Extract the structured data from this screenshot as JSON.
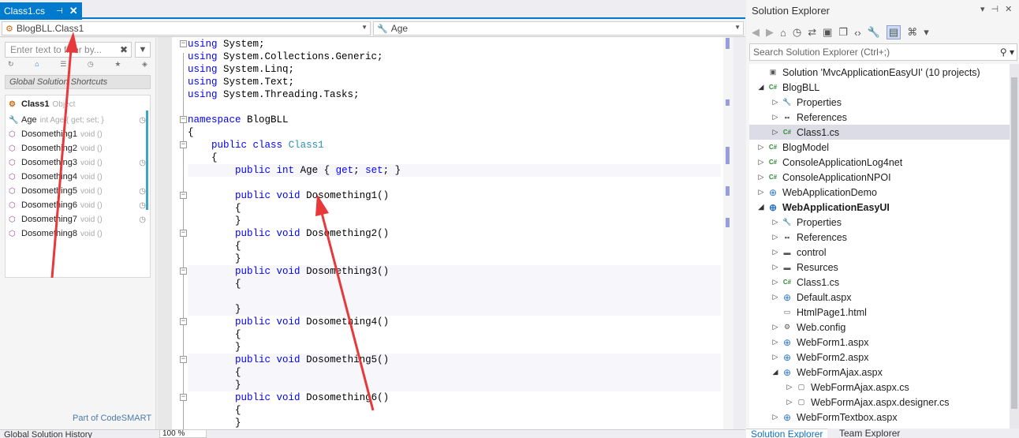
{
  "doc_tab": {
    "title": "Class1.cs",
    "pin_glyph": "⊣",
    "close_glyph": "✕"
  },
  "navbar": {
    "left_value": "BlogBLL.Class1",
    "right_value": "Age"
  },
  "codesmart": {
    "filter_placeholder": "Enter text to filter by...",
    "shortcuts_label": "Global Solution Shortcuts",
    "class_name": "Class1",
    "class_kind": "Object",
    "members": [
      {
        "name": "Age",
        "type": "int Age { get; set; }",
        "icon": "wrench-icon",
        "clock": true
      },
      {
        "name": "Dosomething1",
        "type": "void ()",
        "icon": "method-icon",
        "clock": false
      },
      {
        "name": "Dosomething2",
        "type": "void ()",
        "icon": "method-icon",
        "clock": false
      },
      {
        "name": "Dosomething3",
        "type": "void ()",
        "icon": "method-icon",
        "clock": true
      },
      {
        "name": "Dosomething4",
        "type": "void ()",
        "icon": "method-icon",
        "clock": false
      },
      {
        "name": "Dosomething5",
        "type": "void ()",
        "icon": "method-icon",
        "clock": true
      },
      {
        "name": "Dosomething6",
        "type": "void ()",
        "icon": "method-icon",
        "clock": true
      },
      {
        "name": "Dosomething7",
        "type": "void ()",
        "icon": "method-icon",
        "clock": true
      },
      {
        "name": "Dosomething8",
        "type": "void ()",
        "icon": "method-icon",
        "clock": false
      }
    ],
    "footer_link": "Part of CodeSMART"
  },
  "bottom": {
    "history_label": "Global Solution History",
    "zoom": "100 %"
  },
  "code_lines": [
    "using System;",
    "using System.Collections.Generic;",
    "using System.Linq;",
    "using System.Text;",
    "using System.Threading.Tasks;",
    "",
    "namespace BlogBLL",
    "{",
    "    public class Class1",
    "    {",
    "        public int Age { get; set; }",
    "",
    "        public void Dosomething1()",
    "        {",
    "        }",
    "        public void Dosomething2()",
    "        {",
    "        }",
    "        public void Dosomething3()",
    "        {",
    "",
    "        }",
    "        public void Dosomething4()",
    "        {",
    "        }",
    "        public void Dosomething5()",
    "        {",
    "        }",
    "        public void Dosomething6()",
    "        {",
    "        }"
  ],
  "solution_explorer": {
    "title": "Solution Explorer",
    "search_placeholder": "Search Solution Explorer (Ctrl+;)",
    "tabs": [
      "Solution Explorer",
      "Team Explorer"
    ],
    "tree": [
      {
        "label": "Solution 'MvcApplicationEasyUI' (10 projects)",
        "level": 0,
        "arrow": "",
        "icon": "solution-icon"
      },
      {
        "label": "BlogBLL",
        "level": 0,
        "arrow": "open",
        "icon": "csharp-project-icon"
      },
      {
        "label": "Properties",
        "level": 1,
        "arrow": "closed",
        "icon": "wrench-icon"
      },
      {
        "label": "References",
        "level": 1,
        "arrow": "closed",
        "icon": "references-icon"
      },
      {
        "label": "Class1.cs",
        "level": 1,
        "arrow": "closed",
        "icon": "csharp-file-icon",
        "selected": true
      },
      {
        "label": "BlogModel",
        "level": 0,
        "arrow": "closed",
        "icon": "csharp-project-icon"
      },
      {
        "label": "ConsoleApplicationLog4net",
        "level": 0,
        "arrow": "closed",
        "icon": "csharp-project-icon"
      },
      {
        "label": "ConsoleApplicationNPOI",
        "level": 0,
        "arrow": "closed",
        "icon": "csharp-project-icon"
      },
      {
        "label": "WebApplicationDemo",
        "level": 0,
        "arrow": "closed",
        "icon": "web-project-icon"
      },
      {
        "label": "WebApplicationEasyUI",
        "level": 0,
        "arrow": "open",
        "icon": "web-project-icon",
        "bold": true
      },
      {
        "label": "Properties",
        "level": 1,
        "arrow": "closed",
        "icon": "wrench-icon"
      },
      {
        "label": "References",
        "level": 1,
        "arrow": "closed",
        "icon": "references-icon"
      },
      {
        "label": "control",
        "level": 1,
        "arrow": "closed",
        "icon": "folder-icon"
      },
      {
        "label": "Resurces",
        "level": 1,
        "arrow": "closed",
        "icon": "folder-icon"
      },
      {
        "label": "Class1.cs",
        "level": 1,
        "arrow": "closed",
        "icon": "csharp-file-icon"
      },
      {
        "label": "Default.aspx",
        "level": 1,
        "arrow": "closed",
        "icon": "web-file-icon"
      },
      {
        "label": "HtmlPage1.html",
        "level": 1,
        "arrow": "",
        "icon": "html-file-icon"
      },
      {
        "label": "Web.config",
        "level": 1,
        "arrow": "closed",
        "icon": "config-file-icon"
      },
      {
        "label": "WebForm1.aspx",
        "level": 1,
        "arrow": "closed",
        "icon": "web-file-icon"
      },
      {
        "label": "WebForm2.aspx",
        "level": 1,
        "arrow": "closed",
        "icon": "web-file-icon"
      },
      {
        "label": "WebFormAjax.aspx",
        "level": 1,
        "arrow": "open",
        "icon": "web-file-icon"
      },
      {
        "label": "WebFormAjax.aspx.cs",
        "level": 2,
        "arrow": "closed",
        "icon": "cs-code-file-icon"
      },
      {
        "label": "WebFormAjax.aspx.designer.cs",
        "level": 2,
        "arrow": "closed",
        "icon": "cs-code-file-icon"
      },
      {
        "label": "WebFormTextbox.aspx",
        "level": 1,
        "arrow": "closed",
        "icon": "web-file-icon"
      }
    ]
  },
  "colors": {
    "accent": "#007acc",
    "keyword": "#0000ff",
    "type": "#2b91af",
    "arrow": "#e8393a"
  }
}
